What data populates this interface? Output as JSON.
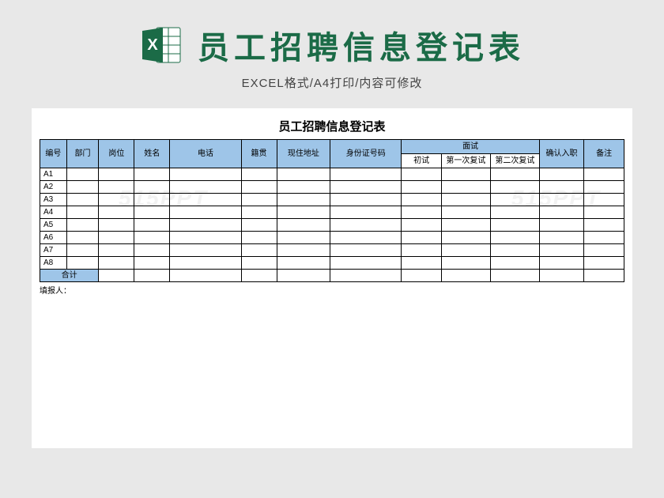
{
  "header": {
    "title": "员工招聘信息登记表",
    "subtitle": "EXCEL格式/A4打印/内容可修改"
  },
  "sheet": {
    "title": "员工招聘信息登记表",
    "columns": {
      "id": "编号",
      "dept": "部门",
      "pos": "岗位",
      "name": "姓名",
      "phone": "电话",
      "origin": "籍贯",
      "addr": "现住地址",
      "idnum": "身份证号码",
      "interview_group": "面试",
      "iv1": "初试",
      "iv2": "第一次复试",
      "iv3": "第二次复试",
      "confirm": "确认入职",
      "note": "备注"
    },
    "rows": [
      "A1",
      "A2",
      "A3",
      "A4",
      "A5",
      "A6",
      "A7",
      "A8"
    ],
    "total_label": "合计",
    "footer": "填报人："
  },
  "watermark": "515PPT"
}
